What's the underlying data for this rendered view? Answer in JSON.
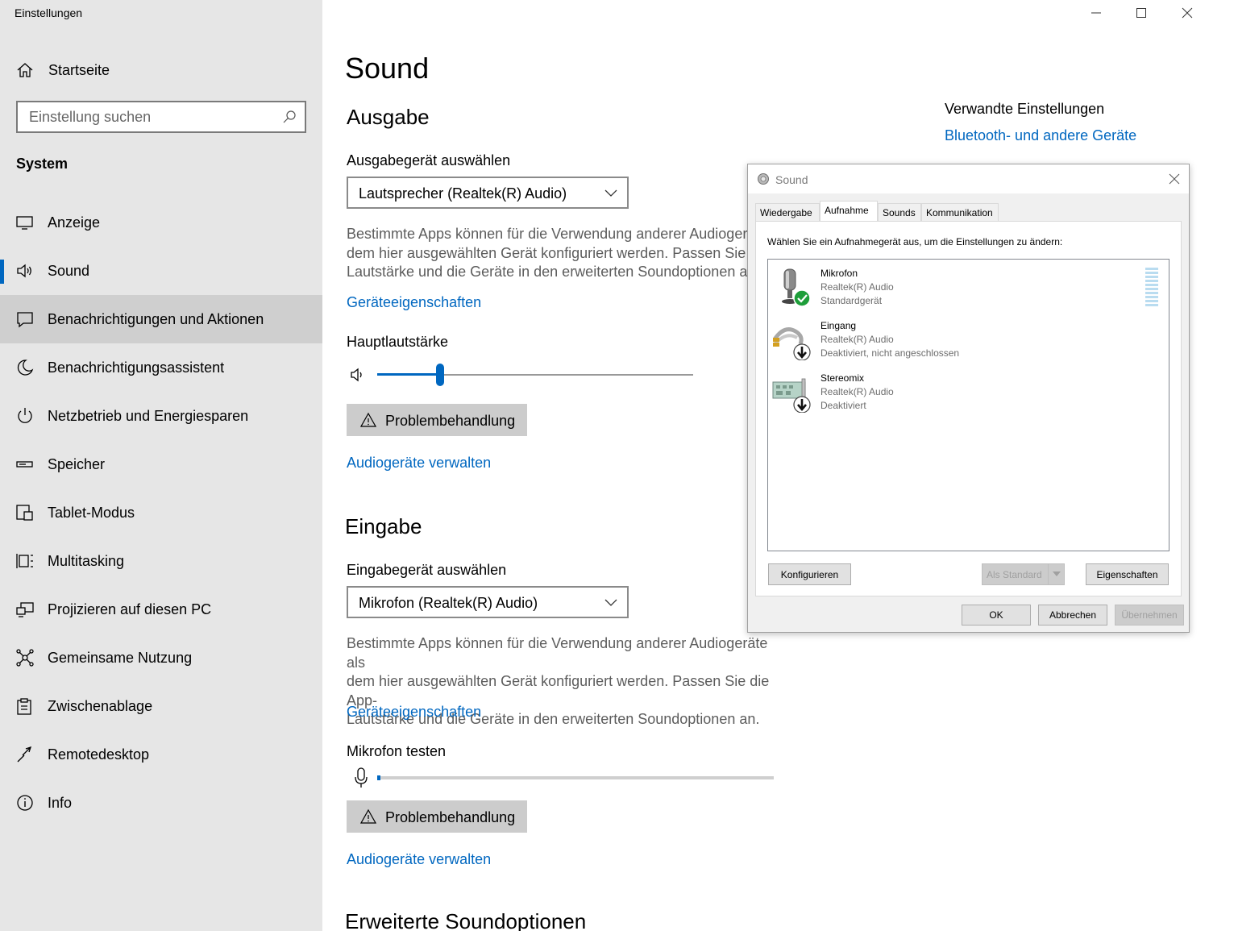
{
  "app": {
    "title": "Einstellungen"
  },
  "sidebar": {
    "home_label": "Startseite",
    "search_placeholder": "Einstellung suchen",
    "section_title": "System",
    "items": [
      {
        "label": "Anzeige",
        "icon": "display-icon"
      },
      {
        "label": "Sound",
        "icon": "speaker-icon",
        "selected": true
      },
      {
        "label": "Benachrichtigungen und Aktionen",
        "icon": "notification-icon",
        "hover": true
      },
      {
        "label": "Benachrichtigungsassistent",
        "icon": "moon-icon"
      },
      {
        "label": "Netzbetrieb und Energiesparen",
        "icon": "power-icon"
      },
      {
        "label": "Speicher",
        "icon": "storage-icon"
      },
      {
        "label": "Tablet-Modus",
        "icon": "tablet-icon"
      },
      {
        "label": "Multitasking",
        "icon": "multitasking-icon"
      },
      {
        "label": "Projizieren auf diesen PC",
        "icon": "project-icon"
      },
      {
        "label": "Gemeinsame Nutzung",
        "icon": "share-icon"
      },
      {
        "label": "Zwischenablage",
        "icon": "clipboard-icon"
      },
      {
        "label": "Remotedesktop",
        "icon": "remote-icon"
      },
      {
        "label": "Info",
        "icon": "info-icon"
      }
    ]
  },
  "main": {
    "page_title": "Sound",
    "output": {
      "heading": "Ausgabe",
      "device_label": "Ausgabegerät auswählen",
      "device_value": "Lautsprecher (Realtek(R) Audio)",
      "desc_line1": "Bestimmte Apps können für die Verwendung anderer Audiogerät",
      "desc_line2": "dem hier ausgewählten Gerät konfiguriert werden. Passen Sie die",
      "desc_line3": "Lautstärke und die Geräte in den erweiterten Soundoptionen an.",
      "properties_link": "Geräteeigenschaften",
      "volume_label": "Hauptlautstärke",
      "volume_level": 0.2,
      "troubleshoot_label": "Problembehandlung",
      "manage_link": "Audiogeräte verwalten"
    },
    "input": {
      "heading": "Eingabe",
      "device_label": "Eingabegerät auswählen",
      "device_value": "Mikrofon (Realtek(R) Audio)",
      "desc_line1": "Bestimmte Apps können für die Verwendung anderer Audiogeräte als",
      "desc_line2": "dem hier ausgewählten Gerät konfiguriert werden. Passen Sie die App-",
      "desc_line3": "Lautstärke und die Geräte in den erweiterten Soundoptionen an.",
      "properties_link": "Geräteeigenschaften",
      "test_label": "Mikrofon testen",
      "troubleshoot_label": "Problembehandlung",
      "manage_link": "Audiogeräte verwalten"
    },
    "advanced_heading": "Erweiterte Soundoptionen",
    "related": {
      "title": "Verwandte Einstellungen",
      "link": "Bluetooth- und andere Geräte"
    }
  },
  "dialog": {
    "title": "Sound",
    "tabs": [
      {
        "label": "Wiedergabe"
      },
      {
        "label": "Aufnahme",
        "active": true
      },
      {
        "label": "Sounds"
      },
      {
        "label": "Kommunikation"
      }
    ],
    "instruction": "Wählen Sie ein Aufnahmegerät aus, um die Einstellungen zu ändern:",
    "devices": [
      {
        "name": "Mikrofon",
        "driver": "Realtek(R) Audio",
        "status": "Standardgerät",
        "icon": "microphone-icon",
        "badge": "check-badge-icon"
      },
      {
        "name": "Eingang",
        "driver": "Realtek(R) Audio",
        "status": "Deaktiviert, nicht angeschlossen",
        "icon": "cable-icon",
        "badge": "down-arrow-badge-icon"
      },
      {
        "name": "Stereomix",
        "driver": "Realtek(R) Audio",
        "status": "Deaktiviert",
        "icon": "soundcard-icon",
        "badge": "down-arrow-badge-icon"
      }
    ],
    "buttons": {
      "configure": "Konfigurieren",
      "set_default": "Als Standard",
      "properties": "Eigenschaften",
      "ok": "OK",
      "cancel": "Abbrechen",
      "apply": "Übernehmen"
    }
  },
  "colors": {
    "accent": "#0067c0",
    "sidebar_bg": "#e6e6e6",
    "hover_bg": "#cfcfcf",
    "button_gray": "#cccccc",
    "check_green": "#1e9e3a"
  }
}
